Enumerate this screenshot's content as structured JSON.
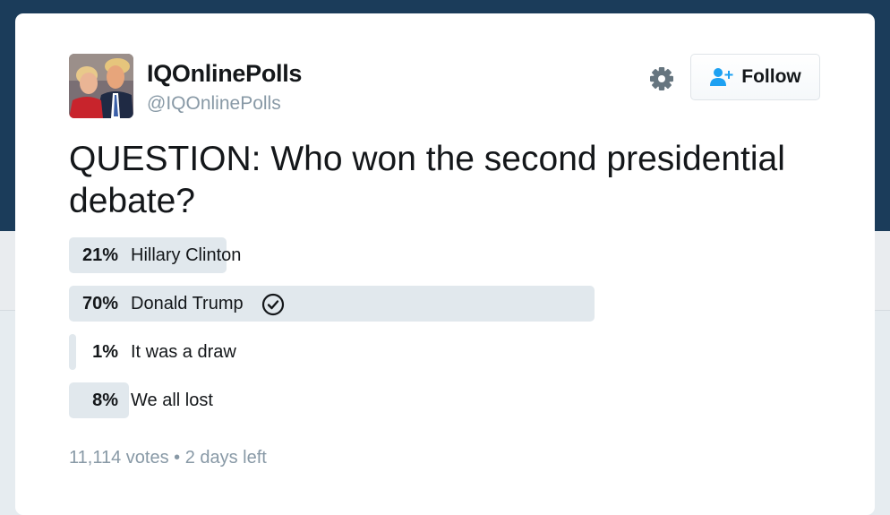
{
  "account": {
    "display_name": "IQOnlinePolls",
    "handle": "@IQOnlinePolls"
  },
  "actions": {
    "follow_label": "Follow"
  },
  "poll": {
    "question": "QUESTION: Who won the second presidential debate?",
    "options": [
      {
        "percent_label": "21%",
        "label": "Hillary Clinton",
        "share": 21,
        "winner": false
      },
      {
        "percent_label": "70%",
        "label": "Donald Trump",
        "share": 70,
        "winner": true
      },
      {
        "percent_label": "1%",
        "label": "It was a draw",
        "share": 1,
        "winner": false
      },
      {
        "percent_label": "8%",
        "label": "We all lost",
        "share": 8,
        "winner": false
      }
    ],
    "votes": "11,114 votes",
    "separator": "•",
    "time_left": "2 days left"
  },
  "icons": {
    "settings": "gear-icon",
    "follow": "add-user-icon",
    "winner": "check-circle-icon"
  },
  "colors": {
    "header_background": "#1b3c5a",
    "bar": "#e1e8ed",
    "follow_icon": "#1da1f2",
    "muted_text": "#8899a6"
  }
}
